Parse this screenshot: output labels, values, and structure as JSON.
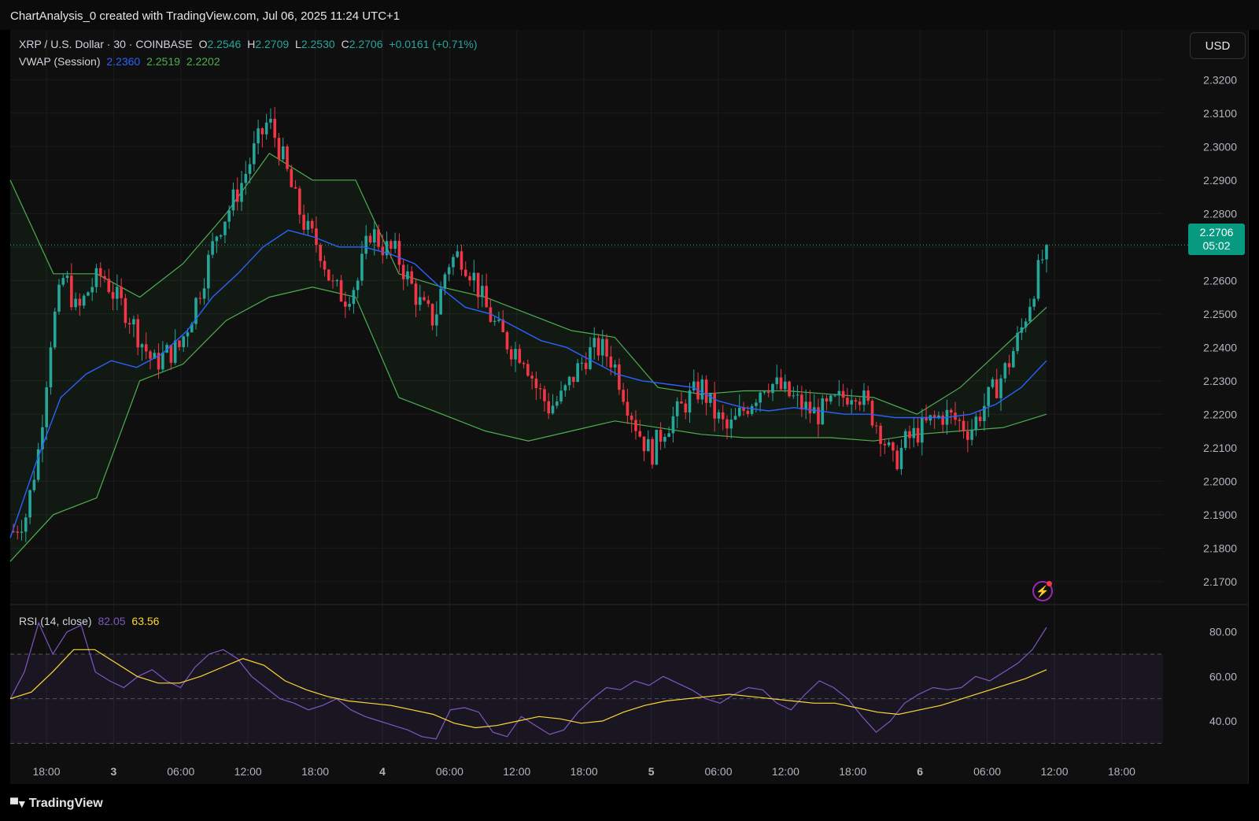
{
  "header": {
    "text": "ChartAnalysis_0 created with TradingView.com, Jul 06, 2025 11:24 UTC+1"
  },
  "symbol": {
    "name": "XRP / U.S. Dollar · 30 · COINBASE",
    "o_label": "O",
    "o": "2.2546",
    "h_label": "H",
    "h": "2.2709",
    "l_label": "L",
    "l": "2.2530",
    "c_label": "C",
    "c": "2.2706",
    "change": "+0.0161 (+0.71%)"
  },
  "vwap": {
    "label": "VWAP (Session)",
    "v1": "2.2360",
    "v2": "2.2519",
    "v3": "2.2202"
  },
  "rsi": {
    "label": "RSI (14, close)",
    "v1": "82.05",
    "v2": "63.56"
  },
  "currency_button": "USD",
  "last_price": {
    "price": "2.2706",
    "countdown": "05:02"
  },
  "footer": {
    "brand": "TradingView"
  },
  "colors": {
    "up": "#26a69a",
    "down": "#f23645",
    "vwap": "#2962ff",
    "band": "#4caf50",
    "rsi": "#7e57c2",
    "rsi_ma": "#fdd835"
  },
  "chart_data": [
    {
      "type": "candlestick",
      "title": "XRP / U.S. Dollar · 30 · COINBASE",
      "ylim": [
        2.165,
        2.325
      ],
      "y_ticks": [
        "2.3200",
        "2.3100",
        "2.3000",
        "2.2900",
        "2.2800",
        "2.2700",
        "2.2600",
        "2.2500",
        "2.2400",
        "2.2300",
        "2.2200",
        "2.2100",
        "2.2000",
        "2.1900",
        "2.1800",
        "2.1700"
      ],
      "x_ticks": [
        "18:00",
        "3",
        "06:00",
        "12:00",
        "18:00",
        "4",
        "06:00",
        "12:00",
        "18:00",
        "5",
        "06:00",
        "12:00",
        "18:00",
        "6",
        "06:00",
        "12:00",
        "18:00"
      ],
      "close_path": [
        2.185,
        2.19,
        2.21,
        2.245,
        2.262,
        2.25,
        2.258,
        2.262,
        2.255,
        2.25,
        2.242,
        2.235,
        2.238,
        2.24,
        2.25,
        2.262,
        2.275,
        2.282,
        2.29,
        2.3,
        2.308,
        2.298,
        2.285,
        2.275,
        2.27,
        2.258,
        2.255,
        2.26,
        2.275,
        2.27,
        2.268,
        2.26,
        2.252,
        2.248,
        2.265,
        2.268,
        2.262,
        2.252,
        2.245,
        2.24,
        2.238,
        2.228,
        2.222,
        2.225,
        2.232,
        2.238,
        2.24,
        2.236,
        2.225,
        2.215,
        2.208,
        2.216,
        2.22,
        2.225,
        2.228,
        2.22,
        2.215,
        2.22,
        2.225,
        2.23,
        2.228,
        2.225,
        2.222,
        2.22,
        2.222,
        2.225,
        2.228,
        2.222,
        2.215,
        2.205,
        2.212,
        2.215,
        2.218,
        2.22,
        2.218,
        2.215,
        2.222,
        2.228,
        2.235,
        2.245,
        2.258,
        2.2706
      ],
      "series": [
        {
          "name": "VWAP",
          "values": [
            2.183,
            2.205,
            2.225,
            2.232,
            2.236,
            2.234,
            2.238,
            2.245,
            2.255,
            2.262,
            2.27,
            2.275,
            2.273,
            2.27,
            2.27,
            2.268,
            2.265,
            2.258,
            2.252,
            2.25,
            2.246,
            2.242,
            2.24,
            2.236,
            2.232,
            2.23,
            2.229,
            2.228,
            2.224,
            2.222,
            2.221,
            2.222,
            2.221,
            2.22,
            2.22,
            2.219,
            2.219,
            2.219,
            2.22,
            2.223,
            2.228,
            2.236
          ]
        },
        {
          "name": "VWAP upper",
          "values": [
            2.29,
            2.262,
            2.262,
            2.255,
            2.265,
            2.28,
            2.298,
            2.29,
            2.29,
            2.262,
            2.258,
            2.255,
            2.25,
            2.245,
            2.243,
            2.228,
            2.226,
            2.227,
            2.227,
            2.226,
            2.225,
            2.22,
            2.228,
            2.24,
            2.252
          ]
        },
        {
          "name": "VWAP lower",
          "values": [
            2.176,
            2.19,
            2.195,
            2.23,
            2.235,
            2.248,
            2.255,
            2.258,
            2.255,
            2.225,
            2.22,
            2.215,
            2.212,
            2.215,
            2.218,
            2.216,
            2.214,
            2.213,
            2.213,
            2.213,
            2.212,
            2.214,
            2.215,
            2.216,
            2.22
          ]
        }
      ]
    },
    {
      "type": "line",
      "title": "RSI (14, close)",
      "ylim": [
        28,
        88
      ],
      "y_ticks": [
        "80.00",
        "60.00",
        "40.00"
      ],
      "series": [
        {
          "name": "RSI",
          "values": [
            50,
            62,
            84,
            70,
            80,
            83,
            62,
            58,
            55,
            60,
            63,
            58,
            55,
            64,
            70,
            72,
            68,
            60,
            55,
            50,
            48,
            45,
            47,
            50,
            45,
            42,
            40,
            38,
            36,
            33,
            32,
            45,
            46,
            44,
            35,
            33,
            42,
            38,
            34,
            36,
            44,
            50,
            55,
            54,
            58,
            56,
            60,
            57,
            54,
            50,
            48,
            52,
            55,
            54,
            48,
            45,
            52,
            58,
            55,
            50,
            42,
            35,
            40,
            48,
            52,
            55,
            54,
            55,
            60,
            58,
            62,
            66,
            72,
            82
          ]
        },
        {
          "name": "RSI MA",
          "values": [
            50,
            53,
            62,
            72,
            72,
            66,
            60,
            57,
            57,
            60,
            64,
            68,
            65,
            58,
            54,
            51,
            49,
            48,
            47,
            45,
            43,
            39,
            37,
            38,
            40,
            42,
            41,
            39,
            40,
            44,
            47,
            49,
            50,
            51,
            52,
            51,
            50,
            49,
            48,
            48,
            46,
            44,
            43,
            45,
            47,
            50,
            53,
            56,
            59,
            63
          ]
        }
      ]
    }
  ]
}
